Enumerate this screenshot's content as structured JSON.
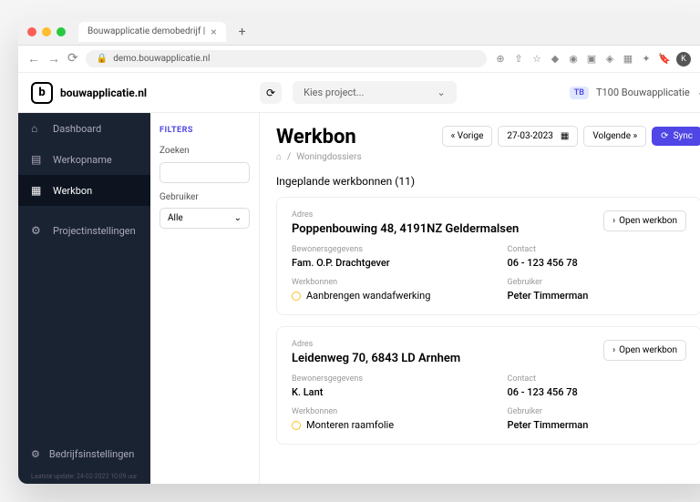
{
  "browser": {
    "tab_title": "Bouwapplicatie demobedrijf |",
    "url": "demo.bouwapplicatie.nl",
    "avatar": "K"
  },
  "topbar": {
    "logo": "bouwapplicatie.nl",
    "project_placeholder": "Kies project...",
    "user_initials": "TB",
    "user_name": "T100 Bouwapplicatie"
  },
  "sidebar": {
    "items": [
      {
        "label": "Dashboard"
      },
      {
        "label": "Werkopname"
      },
      {
        "label": "Werkbon"
      },
      {
        "label": "Projectinstellingen"
      }
    ],
    "bottom": "Bedrijfsinstellingen",
    "footer": "Laatste update: 24-02-2023 10:09 uur"
  },
  "filters": {
    "heading": "FILTERS",
    "search_label": "Zoeken",
    "user_label": "Gebruiker",
    "user_value": "Alle"
  },
  "page": {
    "title": "Werkbon",
    "prev": "« Vorige",
    "date": "27-03-2023",
    "next": "Volgende »",
    "sync": "Sync",
    "breadcrumb": "Woningdossiers",
    "subtitle": "Ingeplande werkbonnen (11)",
    "open_label": "Open werkbon",
    "labels": {
      "address": "Adres",
      "resident": "Bewonersgegevens",
      "contact": "Contact",
      "workorders": "Werkbonnen",
      "user": "Gebruiker"
    },
    "cards": [
      {
        "address": "Poppenbouwing 48, 4191NZ Geldermalsen",
        "resident": "Fam. O.P. Drachtgever",
        "contact": "06 - 123 456 78",
        "workorder": "Aanbrengen wandafwerking",
        "user": "Peter Timmerman"
      },
      {
        "address": "Leidenweg 70, 6843 LD Arnhem",
        "resident": "K. Lant",
        "contact": "06 - 123 456 78",
        "workorder": "Monteren raamfolie",
        "user": "Peter Timmerman"
      }
    ]
  }
}
